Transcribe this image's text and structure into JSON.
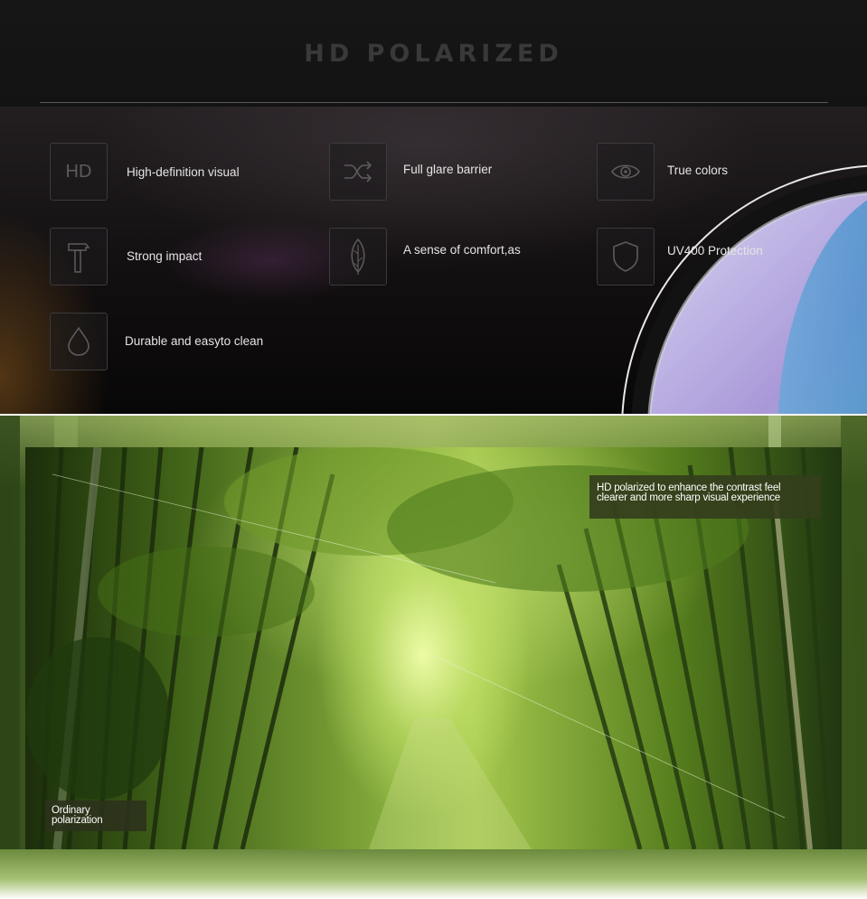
{
  "header": {
    "title": "HD POLARIZED"
  },
  "features": [
    {
      "icon": "hd-icon",
      "icon_text": "HD",
      "label": "High-definition visual"
    },
    {
      "icon": "shuffle-icon",
      "label": "Full glare barrier"
    },
    {
      "icon": "eye-icon",
      "label": "True colors"
    },
    {
      "icon": "hammer-icon",
      "label": "Strong impact"
    },
    {
      "icon": "feather-icon",
      "label": "A sense of comfort,as"
    },
    {
      "icon": "shield-icon",
      "label": "UV400 Protection"
    },
    {
      "icon": "water-drop-icon",
      "label": "Durable and easyto clean"
    }
  ],
  "comparison": {
    "hd_caption": "HD polarized to enhance the contrast feel clearer and more sharp visual experience",
    "ordinary_caption": "Ordinary polarization"
  },
  "colors": {
    "background_dark": "#0c0b0b",
    "title_color": "#3a3838",
    "label_color": "#e6e4e4",
    "icon_stroke": "#5e5b5c",
    "annotation_bg": "#343e1c"
  }
}
